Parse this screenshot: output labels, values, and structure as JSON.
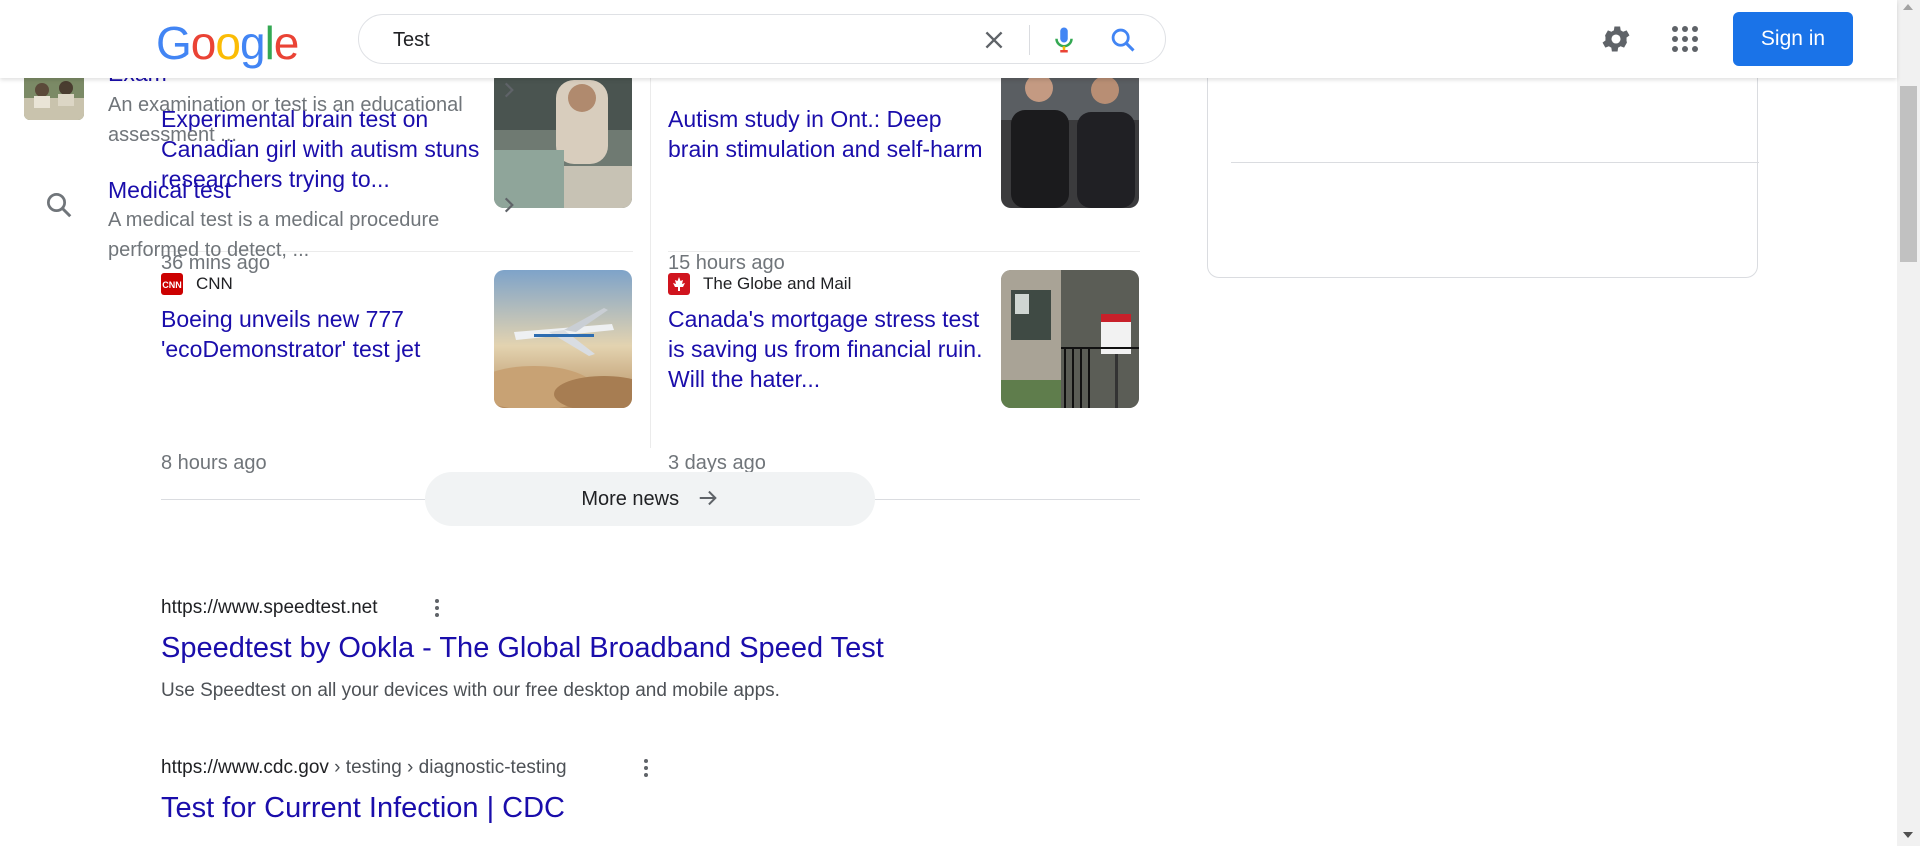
{
  "search": {
    "query": "Test"
  },
  "header": {
    "sign_in_label": "Sign in",
    "logo_text": "Google"
  },
  "news": [
    {
      "source": "",
      "title": "Experimental brain test on Canadian girl with autism stuns researchers trying to...",
      "time": "36 mins ago"
    },
    {
      "source": "",
      "title": "Autism study in Ont.: Deep brain stimulation and self-harm",
      "time": "15 hours ago"
    },
    {
      "source": "CNN",
      "source_icon": "cnn-logo-icon",
      "source_color": "#cc0000",
      "title": "Boeing unveils new 777 'ecoDemonstrator' test jet",
      "time": "8 hours ago"
    },
    {
      "source": "The Globe and Mail",
      "source_icon": "maple-leaf-icon",
      "source_color": "#d0141e",
      "title": "Canada's mortgage stress test is saving us from financial ruin. Will the hater...",
      "time": "3 days ago"
    }
  ],
  "more_news_label": "More news",
  "results": [
    {
      "url": "https://www.speedtest.net",
      "breadcrumb": "",
      "title": "Speedtest by Ookla - The Global Broadband Speed Test",
      "snippet": "Use Speedtest on all your devices with our free desktop and mobile apps."
    },
    {
      "url": "https://www.cdc.gov",
      "breadcrumb": " › testing › diagnostic-testing",
      "title": "Test for Current Infection | CDC",
      "snippet": ""
    }
  ],
  "related": [
    {
      "title": "Exam",
      "description": "An examination or test is an educational assessment ...",
      "icon": "exam-thumbnail"
    },
    {
      "title": "Medical test",
      "description": "A medical test is a medical procedure performed to detect, ...",
      "icon": "search-icon"
    }
  ],
  "colors": {
    "link": "#1a0dab",
    "accent": "#1a73e8",
    "meta": "#70757a"
  }
}
